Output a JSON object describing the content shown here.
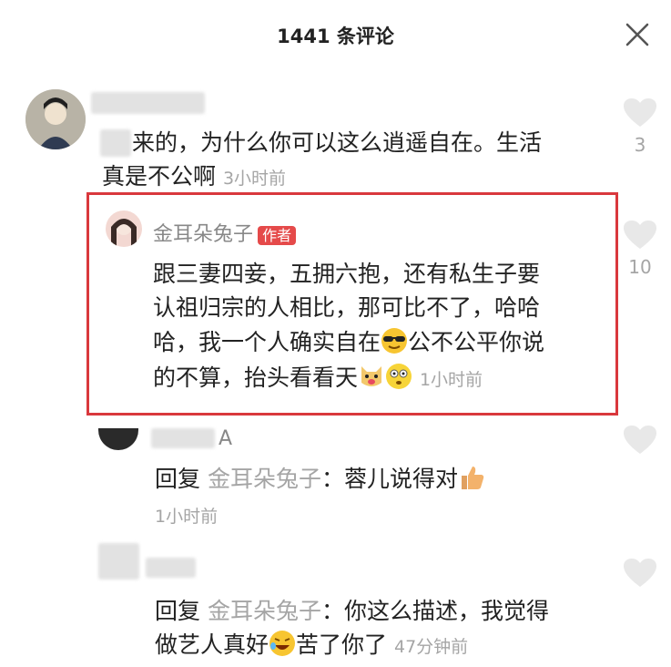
{
  "header": {
    "title": "1441 条评论",
    "close_icon": "close-icon"
  },
  "comments": [
    {
      "name_partial": "...KI...",
      "text_line1": "来的，为什么你可以这么逍遥自在。生活",
      "text_line2": "真是不公啊",
      "time": "3小时前",
      "like_count": "3"
    },
    {
      "author": "金耳朵兔子",
      "badge": "作者",
      "line1": "跟三妻四妾，五拥六抱，还有私生子要",
      "line2": "认祖归宗的人相比，那可比不了，哈哈",
      "line3_a": "哈，我一个人确实自在",
      "line3_b": "公不公平你说",
      "line4": "的不算，抬头看看天",
      "time": "1小时前",
      "like_count": "10"
    },
    {
      "name_partial": "A",
      "reply_prefix": "回复",
      "reply_to": "金耳朵兔子",
      "text": "：蓉儿说得对",
      "time": "1小时前"
    },
    {
      "reply_prefix": "回复",
      "reply_to": "金耳朵兔子",
      "text_line1": "：你这么描述，我觉得",
      "text_line2_a": "做艺人真好",
      "text_line2_b": "苦了你了",
      "time": "47分钟前"
    }
  ],
  "icons": {
    "like": "heart-icon",
    "emoji_cool": "sunglasses-emoji-icon",
    "emoji_dog": "dog-emoji-icon",
    "emoji_dizzy": "dizzy-emoji-icon",
    "emoji_thumb": "thumbs-up-emoji-icon",
    "emoji_laugh": "rolling-laugh-emoji-icon"
  }
}
